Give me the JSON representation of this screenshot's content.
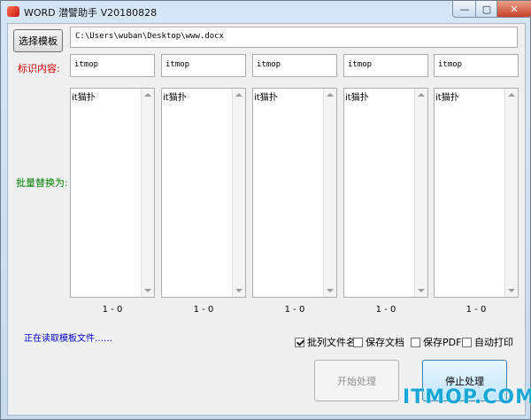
{
  "window": {
    "title": "WORD 潜譬助手 V20180828",
    "min_label": "—",
    "max_label": "▢",
    "close_label": "✕"
  },
  "toolbar": {
    "select_template_label": "选择模板",
    "template_path": "C:\\Users\\wuban\\Desktop\\www.docx"
  },
  "labels": {
    "identify": "标识内容:",
    "batch_replace": "批量替换为:",
    "status": "正在读取模板文件……"
  },
  "columns": [
    {
      "identifier": "itmop",
      "replacement": "it猫扑",
      "count": "1 - 0"
    },
    {
      "identifier": "itmop",
      "replacement": "it猫扑",
      "count": "1 - 0"
    },
    {
      "identifier": "itmop",
      "replacement": "it猫扑",
      "count": "1 - 0"
    },
    {
      "identifier": "itmop",
      "replacement": "it猫扑",
      "count": "1 - 0"
    },
    {
      "identifier": "itmop",
      "replacement": "it猫扑",
      "count": "1 - 0"
    }
  ],
  "options": [
    {
      "label": "批列文件名",
      "checked": true
    },
    {
      "label": "保存文档",
      "checked": false
    },
    {
      "label": "保存PDF",
      "checked": false
    },
    {
      "label": "自动打印",
      "checked": false
    }
  ],
  "actions": {
    "start_label": "开始处理",
    "stop_label": "停止处理"
  },
  "watermark": "ITMOP.COM",
  "colors": {
    "label_red": "#e00000",
    "label_green": "#008000",
    "status_blue": "#0000cc",
    "watermark": "#18a8d8"
  }
}
